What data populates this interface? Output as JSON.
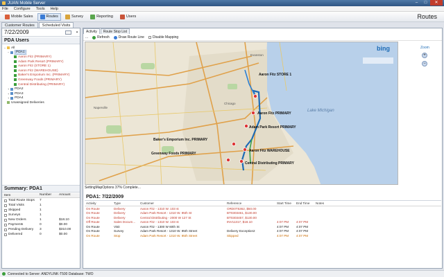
{
  "window": {
    "title": "JUAN Mobile Server",
    "controls": [
      "–",
      "□",
      "✕"
    ]
  },
  "menu": [
    "File",
    "Configure",
    "Tools",
    "Help"
  ],
  "toolbar": {
    "buttons": [
      {
        "label": "Mobile Sales",
        "icon": "mobile-sales-icon",
        "color": "#d95f3a"
      },
      {
        "label": "Routes",
        "icon": "routes-icon",
        "color": "#3a7bd5"
      },
      {
        "label": "Survey",
        "icon": "survey-icon",
        "color": "#d9a43a"
      },
      {
        "label": "Reporting",
        "icon": "reporting-icon",
        "color": "#5aa64e"
      },
      {
        "label": "Users",
        "icon": "users-icon",
        "color": "#c9543a"
      }
    ],
    "active": "Routes",
    "section_title": "Routes"
  },
  "outer_tabs": [
    "Customer Routes",
    "Scheduled Visits"
  ],
  "left": {
    "date": "7/22/2009",
    "users_header": "PDA Users",
    "tree": [
      {
        "level": 0,
        "label": "All",
        "color": "default"
      },
      {
        "level": 1,
        "label": "PDA1",
        "color": "default",
        "selected": true
      },
      {
        "level": 2,
        "label": "Aaron Fitz (PRIMARY)",
        "color": "red"
      },
      {
        "level": 2,
        "label": "Adam Park Resort (PRIMARY)",
        "color": "red"
      },
      {
        "level": 2,
        "label": "Aaron Fitz (STORE 1)",
        "color": "red"
      },
      {
        "level": 2,
        "label": "Aaron Fitz (WAREHOUSE)",
        "color": "red"
      },
      {
        "level": 2,
        "label": "Baker's Emporium Inc. (PRIMARY)",
        "color": "red"
      },
      {
        "level": 2,
        "label": "Greenway Foods (PRIMARY)",
        "color": "red"
      },
      {
        "level": 2,
        "label": "Central Distributing (PRIMARY)",
        "color": "red"
      },
      {
        "level": 1,
        "label": "PDA2",
        "color": "default"
      },
      {
        "level": 1,
        "label": "PDA3",
        "color": "default"
      },
      {
        "level": 1,
        "label": "PDA4",
        "color": "default"
      },
      {
        "level": 0,
        "label": "Unassigned Deliveries",
        "color": "default"
      }
    ],
    "summary_title": "Summary: PDA1",
    "summary_columns": [
      "Item",
      "Number",
      "Amount"
    ],
    "summary_rows": [
      {
        "item": "Total Route Stops",
        "number": "7",
        "amount": ""
      },
      {
        "item": "Total Visits",
        "number": "1",
        "amount": ""
      },
      {
        "item": "Skipped",
        "number": "1",
        "amount": ""
      },
      {
        "item": "Surveys",
        "number": "1",
        "amount": ""
      },
      {
        "item": "New Orders",
        "number": "1",
        "amount": "$18.10"
      },
      {
        "item": "Payments",
        "number": "0",
        "amount": "$0.00"
      },
      {
        "item": "Pending Delivery",
        "number": "3",
        "amount": "$310.00"
      },
      {
        "item": "Delivered",
        "number": "0",
        "amount": "$0.00"
      }
    ]
  },
  "right": {
    "tabs": [
      "Activity",
      "Route Stop List"
    ],
    "map_toolbar": {
      "menu": "...",
      "refresh": "Refresh",
      "draw": "Draw Route Line",
      "disable": "Disable Mapping"
    },
    "map_brand": "bing",
    "zoom_label": "Zoom",
    "lake_label": "Lake Michigan",
    "city_labels": [
      "Naperville",
      "Evanston",
      "Chicago"
    ],
    "map_labels": [
      "Aaron Fitz STORE 1",
      "Aaron Fitz PRIMARY",
      "Adam Park Resort PRIMARY",
      "Baker's Emporium Inc. PRIMARY",
      "Greenway Foods PRIMARY",
      "Aaron Fitz WAREHOUSE",
      "Central Distributing PRIMARY"
    ],
    "map_status": "SettingMapOptions 37% Complete...",
    "pda_title": "PDA1: 7/22/2009",
    "activity_columns": [
      "Activity",
      "Type",
      "Customer",
      "Reference",
      "Start Time",
      "End Time",
      "Notes"
    ],
    "activity_rows": [
      {
        "activity": "On Route",
        "type": "Delivery",
        "customer": "Aaron Fitz - 1310 W. 103 st",
        "reference": "ORD0T5362, $50.00",
        "start": "",
        "end": "",
        "notes": "",
        "color": "red"
      },
      {
        "activity": "On Route",
        "type": "Delivery",
        "customer": "Adam Park Resort - 1310 W. 95th St",
        "reference": "BT0303461, $130.00",
        "start": "",
        "end": "",
        "notes": "",
        "color": "red"
      },
      {
        "activity": "On Route",
        "type": "Delivery",
        "customer": "Central Distributing - 2000 W 127 St",
        "reference": "BT0303457, $130.00",
        "start": "",
        "end": "",
        "notes": "",
        "color": "red"
      },
      {
        "activity": "Off Route",
        "type": "Sales Docum...",
        "customer": "Aaron Fitz - 1310 W. 103 st",
        "reference": "INV11317, $18.10",
        "start": "4:07 PM",
        "end": "4:07 PM",
        "notes": "",
        "color": "red"
      },
      {
        "activity": "On Route",
        "type": "Visit",
        "customer": "Aaron Fitz - 1300 W 60th St",
        "reference": "",
        "start": "4:07 PM",
        "end": "4:07 PM",
        "notes": "",
        "color": "default"
      },
      {
        "activity": "On Route",
        "type": "Survey",
        "customer": "Adam Park Resort - 1310 W. 95th Street",
        "reference": "Delivery Exception2",
        "start": "4:07 PM",
        "end": "4:07 PM",
        "notes": "",
        "color": "default"
      },
      {
        "activity": "On Route",
        "type": "Stop",
        "customer": "Adam Park Resort - 1310 W. 95th Street",
        "reference": "Skipped",
        "start": "4:07 PM",
        "end": "4:07 PM",
        "notes": "",
        "color": "orange"
      }
    ]
  },
  "statusbar": "Connected to Server: ANDYLINK-T500 Database: TWO"
}
